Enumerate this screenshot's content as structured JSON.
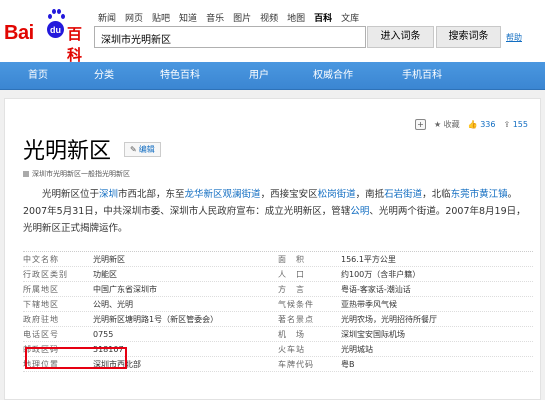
{
  "logo": {
    "text_bai": "Bai",
    "text_du": "du",
    "text_baike": "百科"
  },
  "nav_links": [
    "新闻",
    "网页",
    "贴吧",
    "知道",
    "音乐",
    "图片",
    "视频",
    "地图",
    "百科",
    "文库"
  ],
  "nav_current": "百科",
  "search": {
    "value": "深圳市光明新区"
  },
  "buttons": {
    "enter": "进入词条",
    "search": "搜索词条",
    "help": "帮助"
  },
  "bluebar": [
    "首页",
    "分类",
    "特色百科",
    "用户",
    "权威合作",
    "手机百科"
  ],
  "tools": {
    "favorite_label": "收藏",
    "like_count": "336",
    "share_count": "155"
  },
  "page": {
    "title": "光明新区",
    "edit_label": "编辑",
    "subtitle": "深圳市光明新区一般指光明新区"
  },
  "summary": {
    "p1": "光明新区位于",
    "l1": "深圳",
    "p2": "市西北部，东至",
    "l2": "龙华新区观澜街道",
    "p3": "，西接宝安区",
    "l3": "松岗街道",
    "p4": "，南抵",
    "l4": "石岩街道",
    "p5": "，北临",
    "l5": "东莞市黄江镇",
    "p6": "。2007年5月31日，中共深圳市委、深圳市人民政府宣布：成立光明新区，管辖",
    "l6": "公明",
    "p7": "、光明两个街道。2007年8月19日，光明新区正式揭牌运作。"
  },
  "info": [
    {
      "k1": "中文名称",
      "v1": "光明新区",
      "k2": "面　积",
      "v2": "156.1平方公里",
      "v2link": false
    },
    {
      "k1": "行政区类别",
      "v1": "功能区",
      "k2": "人　口",
      "v2": "约100万（含非户籍）",
      "v2link": false
    },
    {
      "k1": "所属地区",
      "v1": "中国广东省深圳市",
      "k2": "方　言",
      "v2": "粤语-客家话-潮汕话",
      "v2link": true
    },
    {
      "k1": "下辖地区",
      "v1": "公明、光明",
      "k2": "气候条件",
      "v2": "亚热带季风气候",
      "v2link": true
    },
    {
      "k1": "政府驻地",
      "v1": "光明新区塘明路1号（新区管委会）",
      "k2": "著名景点",
      "v2": "光明农场，光明招待所餐厅",
      "v2link": false
    },
    {
      "k1": "电话区号",
      "v1": "0755",
      "k2": "机　场",
      "v2": "深圳宝安国际机场",
      "v2link": true
    },
    {
      "k1": "邮政区码",
      "v1": "518107",
      "k2": "火车站",
      "v2": "光明城站",
      "v2link": true
    },
    {
      "k1": "地理位置",
      "v1": "深圳市西北部",
      "k2": "车牌代码",
      "v2": "粤B",
      "v2link": false
    }
  ],
  "colors": {
    "accent_blue": "#3b86d2",
    "brand_red": "#e10602",
    "link": "#136ec2",
    "highlight": "#e60012"
  }
}
